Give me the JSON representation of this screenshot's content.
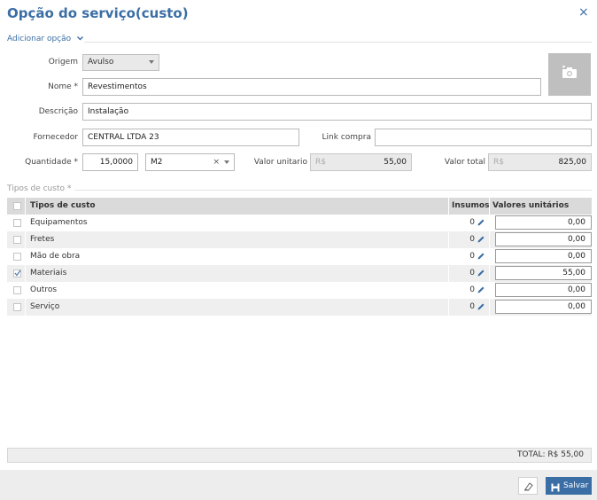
{
  "dialog": {
    "title": "Opção do serviço(custo)",
    "close_label": "×"
  },
  "section": {
    "label": "Adicionar opção"
  },
  "form": {
    "origem_label": "Origem",
    "origem_value": "Avulso",
    "nome_label": "Nome *",
    "nome_value": "Revestimentos",
    "descricao_label": "Descrição",
    "descricao_value": "Instalação",
    "fornecedor_label": "Fornecedor",
    "fornecedor_value": "CENTRAL LTDA 23",
    "link_label": "Link compra",
    "link_value": "",
    "quantidade_label": "Quantidade *",
    "quantidade_value": "15,0000",
    "unidade_value": "M2",
    "unidade_clear": "×",
    "valor_unitario_label": "Valor unitario",
    "valor_unitario_currency": "R$",
    "valor_unitario_value": "55,00",
    "valor_total_label": "Valor total",
    "valor_total_currency": "R$",
    "valor_total_value": "825,00"
  },
  "cost_types": {
    "section_label": "Tipos de custo *",
    "headers": {
      "tipo": "Tipos de custo",
      "insumos": "Insumos",
      "valores": "Valores unitários"
    },
    "rows": [
      {
        "tipo": "Equipamentos",
        "insumos": "0",
        "valor": "0,00",
        "checked": false
      },
      {
        "tipo": "Fretes",
        "insumos": "0",
        "valor": "0,00",
        "checked": false
      },
      {
        "tipo": "Mão de obra",
        "insumos": "0",
        "valor": "0,00",
        "checked": false
      },
      {
        "tipo": "Materiais",
        "insumos": "0",
        "valor": "55,00",
        "checked": true
      },
      {
        "tipo": "Outros",
        "insumos": "0",
        "valor": "0,00",
        "checked": false
      },
      {
        "tipo": "Serviço",
        "insumos": "0",
        "valor": "0,00",
        "checked": false
      }
    ],
    "total": "TOTAL: R$ 55,00"
  },
  "footer": {
    "save_label": "Salvar"
  },
  "colors": {
    "accent": "#3a6ea5",
    "header_bg": "#dadada",
    "row_alt": "#efefef",
    "footer_bg": "#ededed"
  }
}
